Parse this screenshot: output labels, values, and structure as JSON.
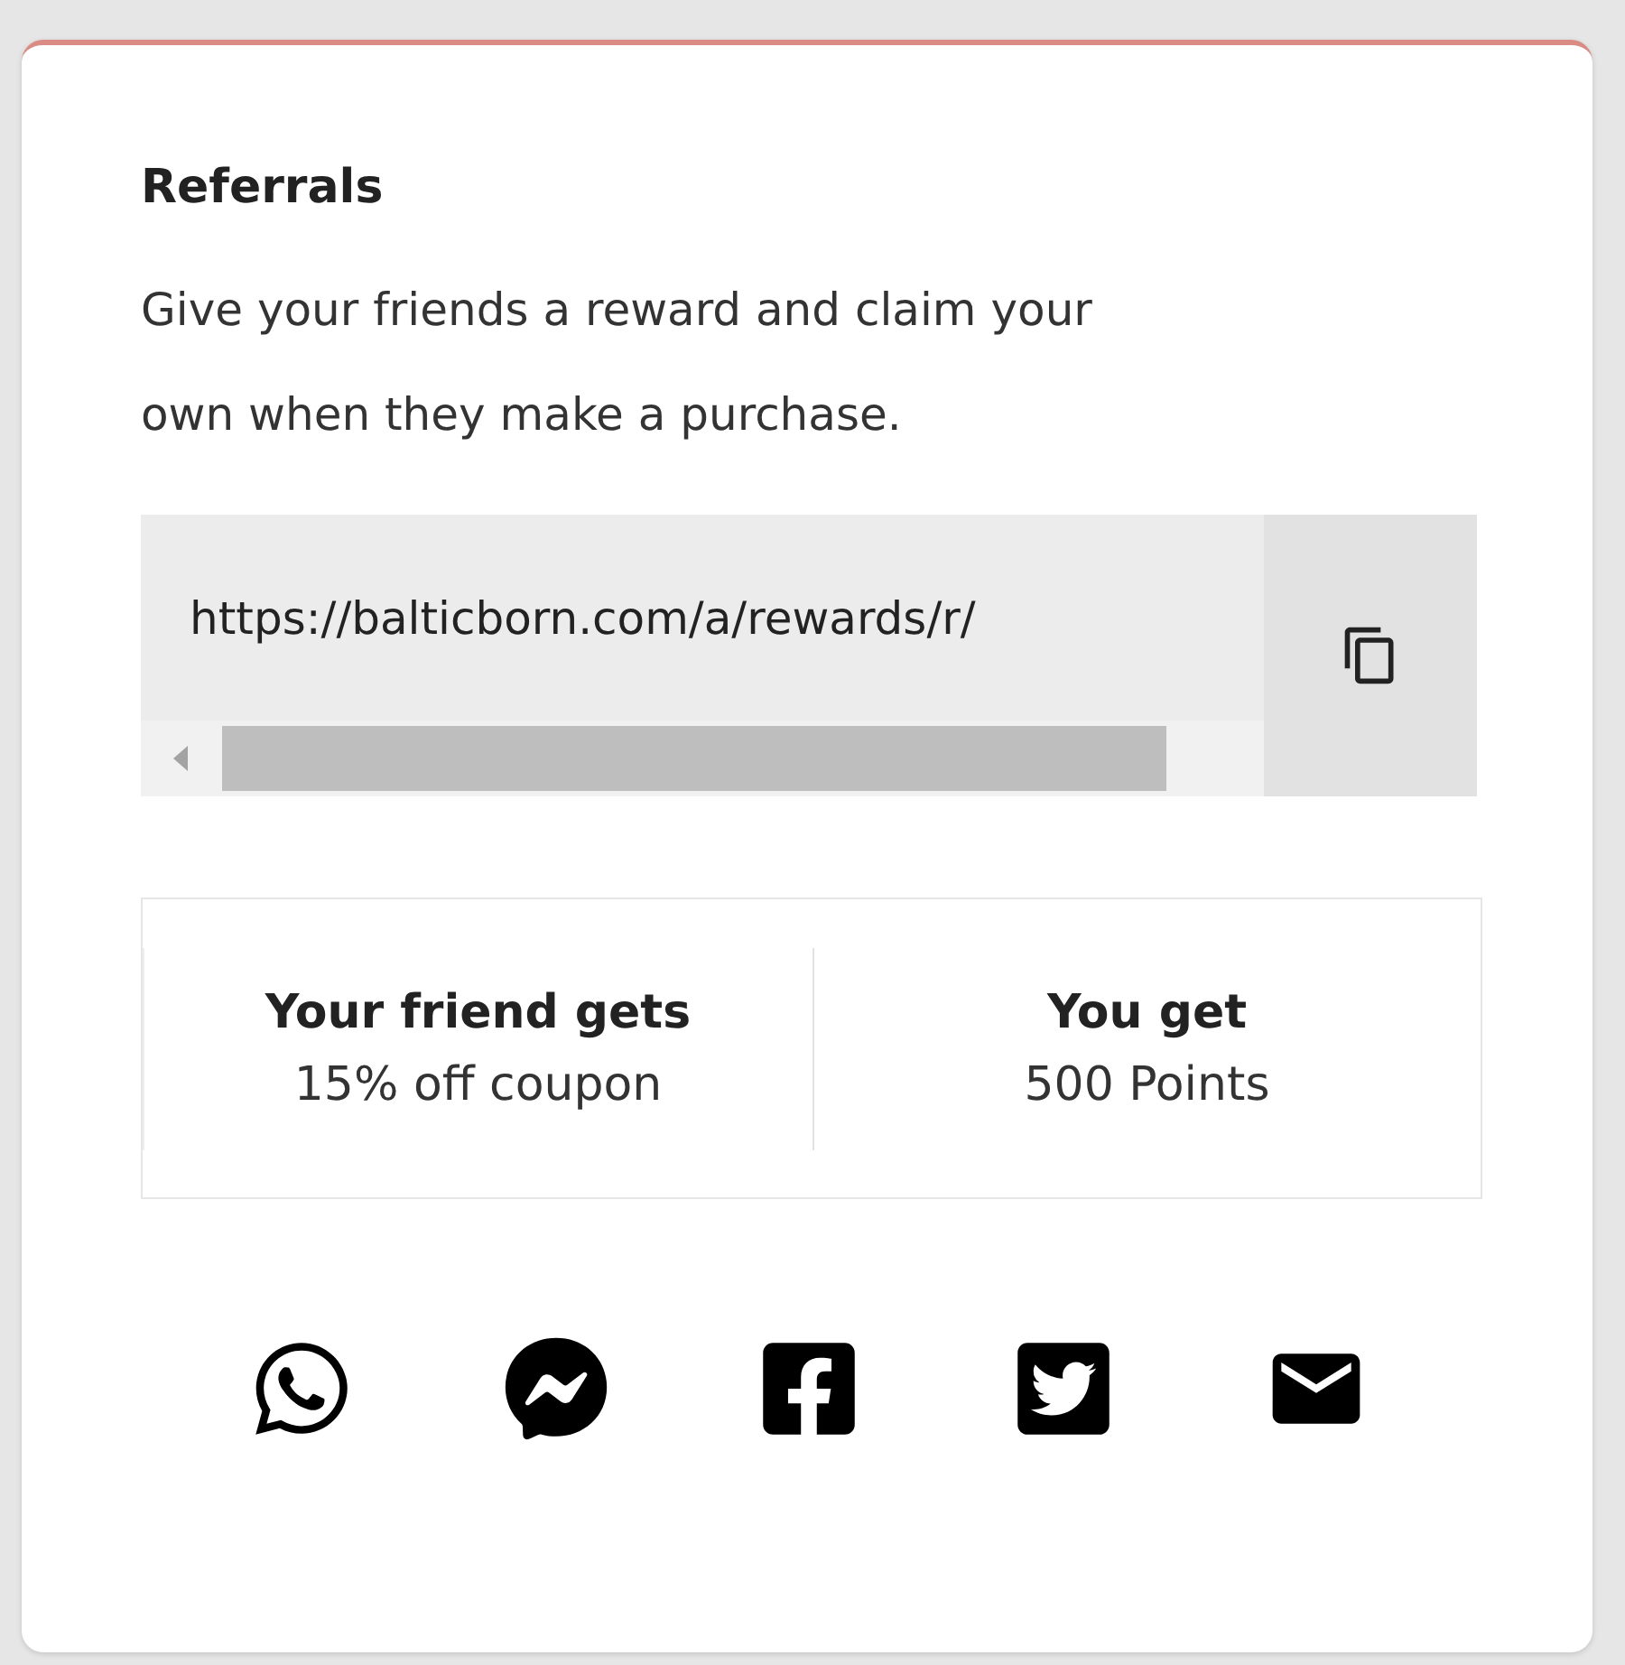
{
  "card": {
    "title": "Referrals",
    "description": "Give your friends a reward and claim your own when they make a purchase.",
    "link": {
      "value": "https://balticborn.com/a/rewards/r/"
    },
    "rewards": [
      {
        "heading": "Your friend gets",
        "value": "15% off coupon"
      },
      {
        "heading": "You get",
        "value": "500 Points"
      }
    ],
    "share": [
      {
        "kind": "whatsapp"
      },
      {
        "kind": "messenger"
      },
      {
        "kind": "facebook"
      },
      {
        "kind": "twitter"
      },
      {
        "kind": "email"
      }
    ]
  }
}
